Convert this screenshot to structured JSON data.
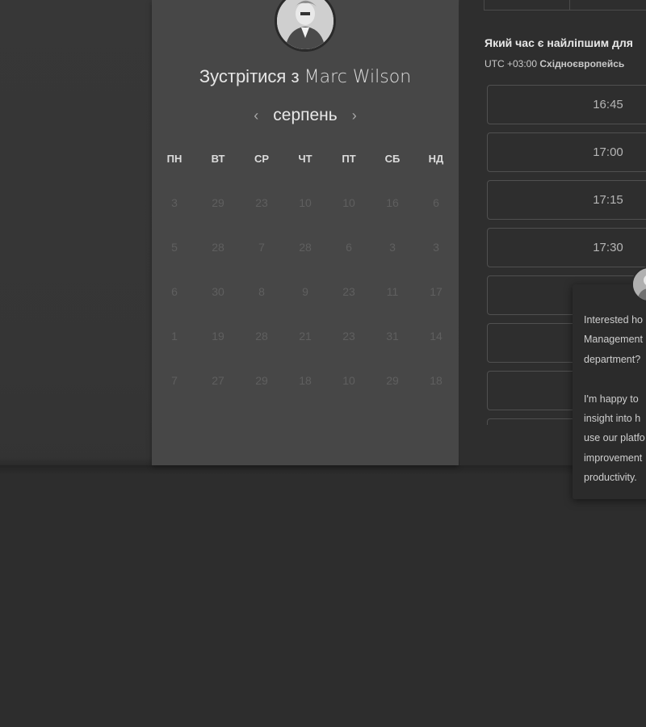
{
  "booking": {
    "meet_prefix": "Зустрітися з",
    "host_name": "Marc Wilson",
    "month": "серпень",
    "prev_icon": "chevron-left-icon",
    "next_icon": "chevron-right-icon",
    "weekdays": [
      "ПН",
      "ВТ",
      "СР",
      "ЧТ",
      "ПТ",
      "СБ",
      "НД"
    ],
    "days": [
      [
        "3",
        "29",
        "23",
        "10",
        "10",
        "16",
        "6"
      ],
      [
        "5",
        "28",
        "7",
        "28",
        "6",
        "3",
        "3"
      ],
      [
        "6",
        "30",
        "8",
        "9",
        "23",
        "11",
        "17"
      ],
      [
        "1",
        "19",
        "28",
        "21",
        "23",
        "31",
        "14"
      ],
      [
        "7",
        "27",
        "29",
        "18",
        "10",
        "29",
        "18"
      ]
    ]
  },
  "times": {
    "question": "Який час є найліпшим для",
    "tz_offset": "UTC +03:00",
    "tz_name": "Східноєвропейсь",
    "slots": [
      "16:45",
      "17:00",
      "17:15",
      "17:30",
      "",
      "",
      ""
    ]
  },
  "chat": {
    "lines": [
      "Interested ho",
      "Management",
      "department?",
      "",
      "I'm happy to",
      "insight into h",
      "use our platfo",
      "improvement",
      "productivity."
    ]
  },
  "colors": {
    "panel_bg": "#474747",
    "right_bg": "#2e2e2e",
    "page_bg": "#2d2d2d"
  }
}
